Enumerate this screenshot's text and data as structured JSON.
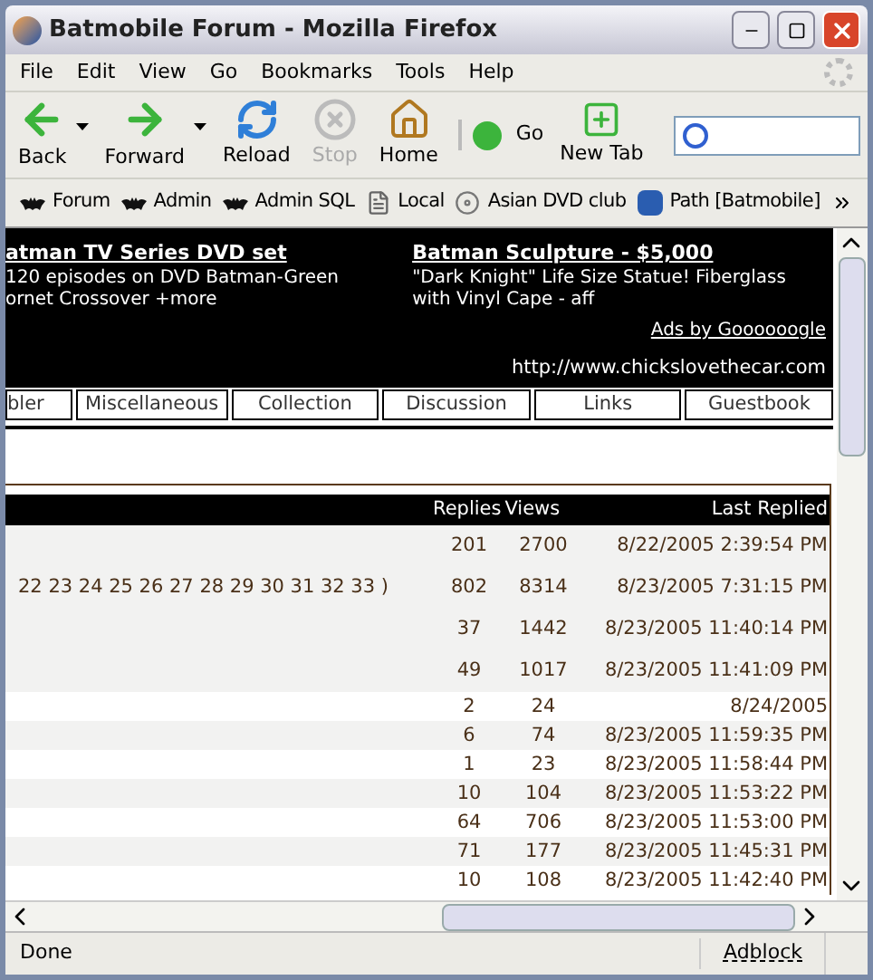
{
  "window": {
    "title": "Batmobile Forum - Mozilla Firefox"
  },
  "menu": [
    "File",
    "Edit",
    "View",
    "Go",
    "Bookmarks",
    "Tools",
    "Help"
  ],
  "toolbar": [
    {
      "label": "Back",
      "kind": "back",
      "disabled": false
    },
    {
      "label": "Forward",
      "kind": "forward",
      "disabled": false
    },
    {
      "label": "Reload",
      "kind": "reload",
      "disabled": false
    },
    {
      "label": "Stop",
      "kind": "stop",
      "disabled": true
    },
    {
      "label": "Home",
      "kind": "home",
      "disabled": false
    },
    {
      "label": "Go",
      "kind": "go",
      "disabled": false
    },
    {
      "label": "New Tab",
      "kind": "newtab",
      "disabled": false
    }
  ],
  "bookmarks": [
    {
      "label": "Forum",
      "kind": "bat"
    },
    {
      "label": "Admin",
      "kind": "bat"
    },
    {
      "label": "Admin SQL",
      "kind": "bat"
    },
    {
      "label": "Local",
      "kind": "page"
    },
    {
      "label": "Asian DVD club",
      "kind": "disc"
    },
    {
      "label": "Path [Batmobile]",
      "kind": "app"
    }
  ],
  "ads": [
    {
      "title": "atman TV Series DVD set",
      "text": "120 episodes on DVD Batman-Green ornet Crossover +more"
    },
    {
      "title": "Batman Sculpture - $5,000",
      "text": "\"Dark Knight\" Life Size Statue! Fiberglass with Vinyl Cape - aff"
    }
  ],
  "ads_by": "Ads by Goooooogle",
  "site_url": "http://www.chickslovethecar.com",
  "nav_tabs": [
    "bler",
    "Miscellaneous",
    "Collection",
    "Discussion",
    "Links",
    "Guestbook"
  ],
  "table": {
    "columns": [
      "Replies",
      "Views",
      "Last Replied"
    ],
    "rows": [
      {
        "topic": "",
        "replies": "201",
        "views": "2700",
        "last": "8/22/2005 2:39:54 PM",
        "shaded": true,
        "kind": "tall"
      },
      {
        "topic": "22 23 24 25 26 27 28 29 30 31 32 33 )",
        "replies": "802",
        "views": "8314",
        "last": "8/23/2005 7:31:15 PM",
        "shaded": true,
        "kind": "tall"
      },
      {
        "topic": "",
        "replies": "37",
        "views": "1442",
        "last": "8/23/2005 11:40:14 PM",
        "shaded": true,
        "kind": "tall"
      },
      {
        "topic": "",
        "replies": "49",
        "views": "1017",
        "last": "8/23/2005 11:41:09 PM",
        "shaded": true,
        "kind": "tall"
      },
      {
        "topic": "",
        "replies": "2",
        "views": "24",
        "last": "8/24/2005",
        "shaded": false,
        "kind": "short"
      },
      {
        "topic": "",
        "replies": "6",
        "views": "74",
        "last": "8/23/2005 11:59:35 PM",
        "shaded": true,
        "kind": "short"
      },
      {
        "topic": "",
        "replies": "1",
        "views": "23",
        "last": "8/23/2005 11:58:44 PM",
        "shaded": false,
        "kind": "short"
      },
      {
        "topic": "",
        "replies": "10",
        "views": "104",
        "last": "8/23/2005 11:53:22 PM",
        "shaded": true,
        "kind": "short"
      },
      {
        "topic": "",
        "replies": "64",
        "views": "706",
        "last": "8/23/2005 11:53:00 PM",
        "shaded": false,
        "kind": "short"
      },
      {
        "topic": "",
        "replies": "71",
        "views": "177",
        "last": "8/23/2005 11:45:31 PM",
        "shaded": true,
        "kind": "short"
      },
      {
        "topic": "",
        "replies": "10",
        "views": "108",
        "last": "8/23/2005 11:42:40 PM",
        "shaded": false,
        "kind": "short"
      }
    ]
  },
  "status_bar": {
    "text": "Done",
    "adblock": "Adblock"
  }
}
